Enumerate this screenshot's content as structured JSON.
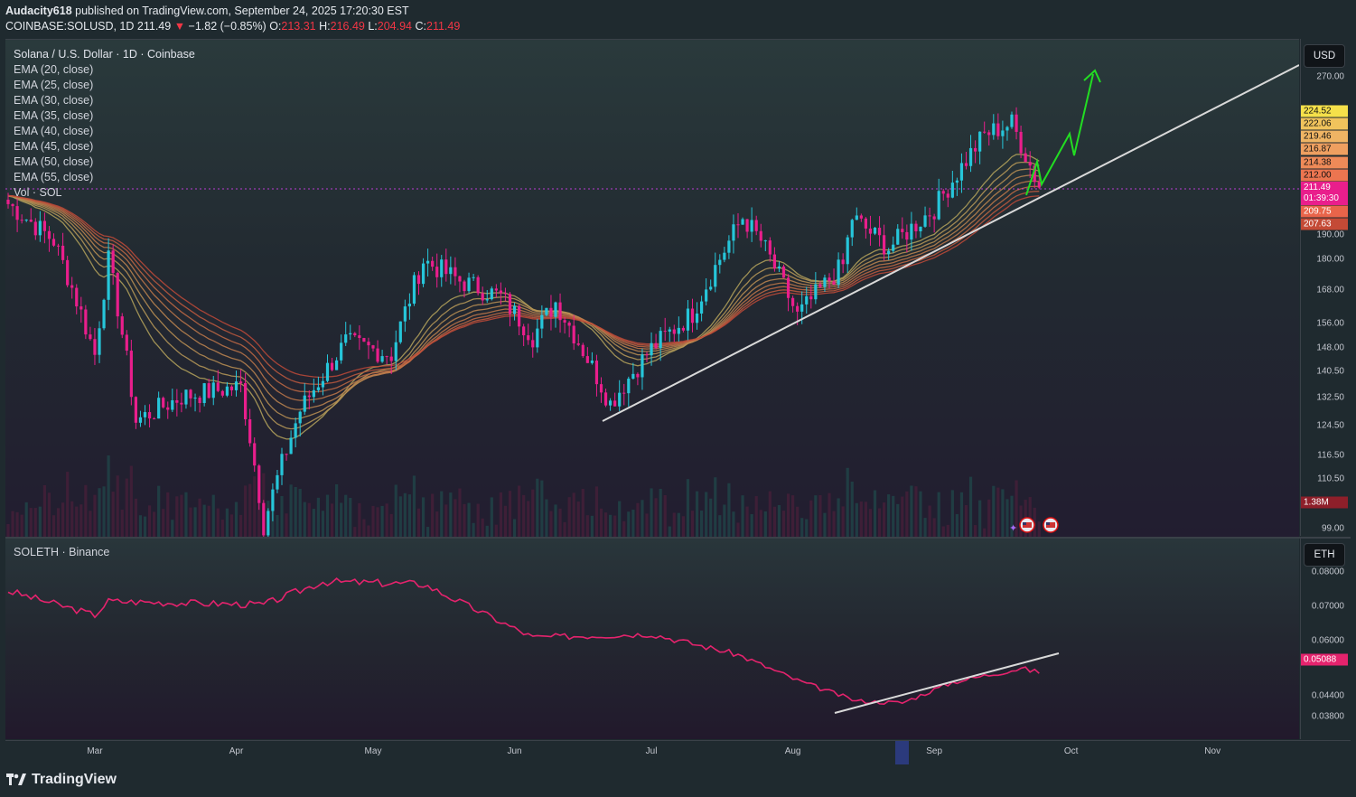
{
  "header": {
    "publisher": "Audacity618",
    "published_text": "published on TradingView.com, September 24, 2025 17:20:30 EST",
    "symbol": "COINBASE:SOLUSD, 1D",
    "last": "211.49",
    "change_arrow": "▼",
    "change": "−1.82 (−0.85%)",
    "open_label": "O:",
    "open": "213.31",
    "high_label": "H:",
    "high": "216.49",
    "low_label": "L:",
    "low": "204.94",
    "close_label": "C:",
    "close": "211.49"
  },
  "main_legend": {
    "title": "Solana / U.S. Dollar · 1D · Coinbase",
    "indicators": [
      "EMA (20, close)",
      "EMA (25, close)",
      "EMA (30, close)",
      "EMA (35, close)",
      "EMA (40, close)",
      "EMA (45, close)",
      "EMA (50, close)",
      "EMA (55, close)",
      "Vol · SOL"
    ]
  },
  "sub_legend": {
    "title": "SOLETH · Binance"
  },
  "price_scale": {
    "currency": "USD",
    "ticks": [
      "270.00",
      "190.00",
      "180.00",
      "168.00",
      "156.00",
      "148.00",
      "140.50",
      "132.50",
      "124.50",
      "116.50",
      "110.50",
      "99.00"
    ],
    "labels": [
      {
        "text": "224.52",
        "color": "#f5e04a"
      },
      {
        "text": "222.06",
        "color": "#f0c35c"
      },
      {
        "text": "219.46",
        "color": "#efb464"
      },
      {
        "text": "216.87",
        "color": "#ee9f60"
      },
      {
        "text": "214.38",
        "color": "#ee8a58"
      },
      {
        "text": "212.00",
        "color": "#ec7550"
      },
      {
        "text": "209.75",
        "color": "#e9644a"
      },
      {
        "text": "207.63",
        "color": "#c44a36"
      }
    ],
    "current_price": "211.49",
    "countdown": "01:39:30",
    "volume_label": "1.38M"
  },
  "sub_scale": {
    "currency": "ETH",
    "ticks": [
      "0.08000",
      "0.07000",
      "0.06000",
      "0.04400",
      "0.03800"
    ],
    "current": "0.05088"
  },
  "time_axis": [
    "Mar",
    "Apr",
    "May",
    "Jun",
    "Jul",
    "Aug",
    "Sep",
    "Oct",
    "Nov"
  ],
  "footer": {
    "brand": "TradingView"
  },
  "colors": {
    "up": "#26c6da",
    "down": "#e91e8c",
    "ema_near": "#b8a35a",
    "ema_far": "#c0392b",
    "sub_line": "#e5236d",
    "projection": "#22dd22"
  },
  "chart_data": {
    "type": "candlestick",
    "title": "Solana / U.S. Dollar · 1D · Coinbase",
    "x_range": [
      "2025-02-10",
      "2025-11-30"
    ],
    "y_range": [
      99,
      290
    ],
    "scale": "log",
    "closes_approx": [
      {
        "date": "2025-02-10",
        "close": 204
      },
      {
        "date": "2025-02-20",
        "close": 188
      },
      {
        "date": "2025-03-01",
        "close": 146
      },
      {
        "date": "2025-03-04",
        "close": 180
      },
      {
        "date": "2025-03-10",
        "close": 126
      },
      {
        "date": "2025-03-20",
        "close": 133
      },
      {
        "date": "2025-04-02",
        "close": 136
      },
      {
        "date": "2025-04-07",
        "close": 100
      },
      {
        "date": "2025-04-15",
        "close": 129
      },
      {
        "date": "2025-04-25",
        "close": 150
      },
      {
        "date": "2025-05-05",
        "close": 146
      },
      {
        "date": "2025-05-12",
        "close": 180
      },
      {
        "date": "2025-05-20",
        "close": 172
      },
      {
        "date": "2025-05-29",
        "close": 166
      },
      {
        "date": "2025-06-05",
        "close": 152
      },
      {
        "date": "2025-06-10",
        "close": 164
      },
      {
        "date": "2025-06-22",
        "close": 131
      },
      {
        "date": "2025-07-01",
        "close": 148
      },
      {
        "date": "2025-07-10",
        "close": 160
      },
      {
        "date": "2025-07-21",
        "close": 198
      },
      {
        "date": "2025-07-25",
        "close": 188
      },
      {
        "date": "2025-08-02",
        "close": 159
      },
      {
        "date": "2025-08-12",
        "close": 178
      },
      {
        "date": "2025-08-14",
        "close": 198
      },
      {
        "date": "2025-08-22",
        "close": 185
      },
      {
        "date": "2025-09-01",
        "close": 202
      },
      {
        "date": "2025-09-12",
        "close": 238
      },
      {
        "date": "2025-09-18",
        "close": 244
      },
      {
        "date": "2025-09-24",
        "close": 211.49
      }
    ],
    "ema_levels_last": [
      224.52,
      222.06,
      219.46,
      216.87,
      214.38,
      212.0,
      209.75,
      207.63
    ],
    "soleth_series": [
      {
        "date": "2025-02-10",
        "value": 0.0745
      },
      {
        "date": "2025-03-01",
        "value": 0.0675
      },
      {
        "date": "2025-03-04",
        "value": 0.0715
      },
      {
        "date": "2025-04-07",
        "value": 0.0705
      },
      {
        "date": "2025-04-20",
        "value": 0.0772
      },
      {
        "date": "2025-05-12",
        "value": 0.0765
      },
      {
        "date": "2025-06-05",
        "value": 0.061
      },
      {
        "date": "2025-07-01",
        "value": 0.062
      },
      {
        "date": "2025-07-20",
        "value": 0.056
      },
      {
        "date": "2025-08-02",
        "value": 0.0485
      },
      {
        "date": "2025-08-15",
        "value": 0.0425
      },
      {
        "date": "2025-08-25",
        "value": 0.042
      },
      {
        "date": "2025-09-05",
        "value": 0.048
      },
      {
        "date": "2025-09-20",
        "value": 0.052
      },
      {
        "date": "2025-09-24",
        "value": 0.05088
      }
    ]
  }
}
